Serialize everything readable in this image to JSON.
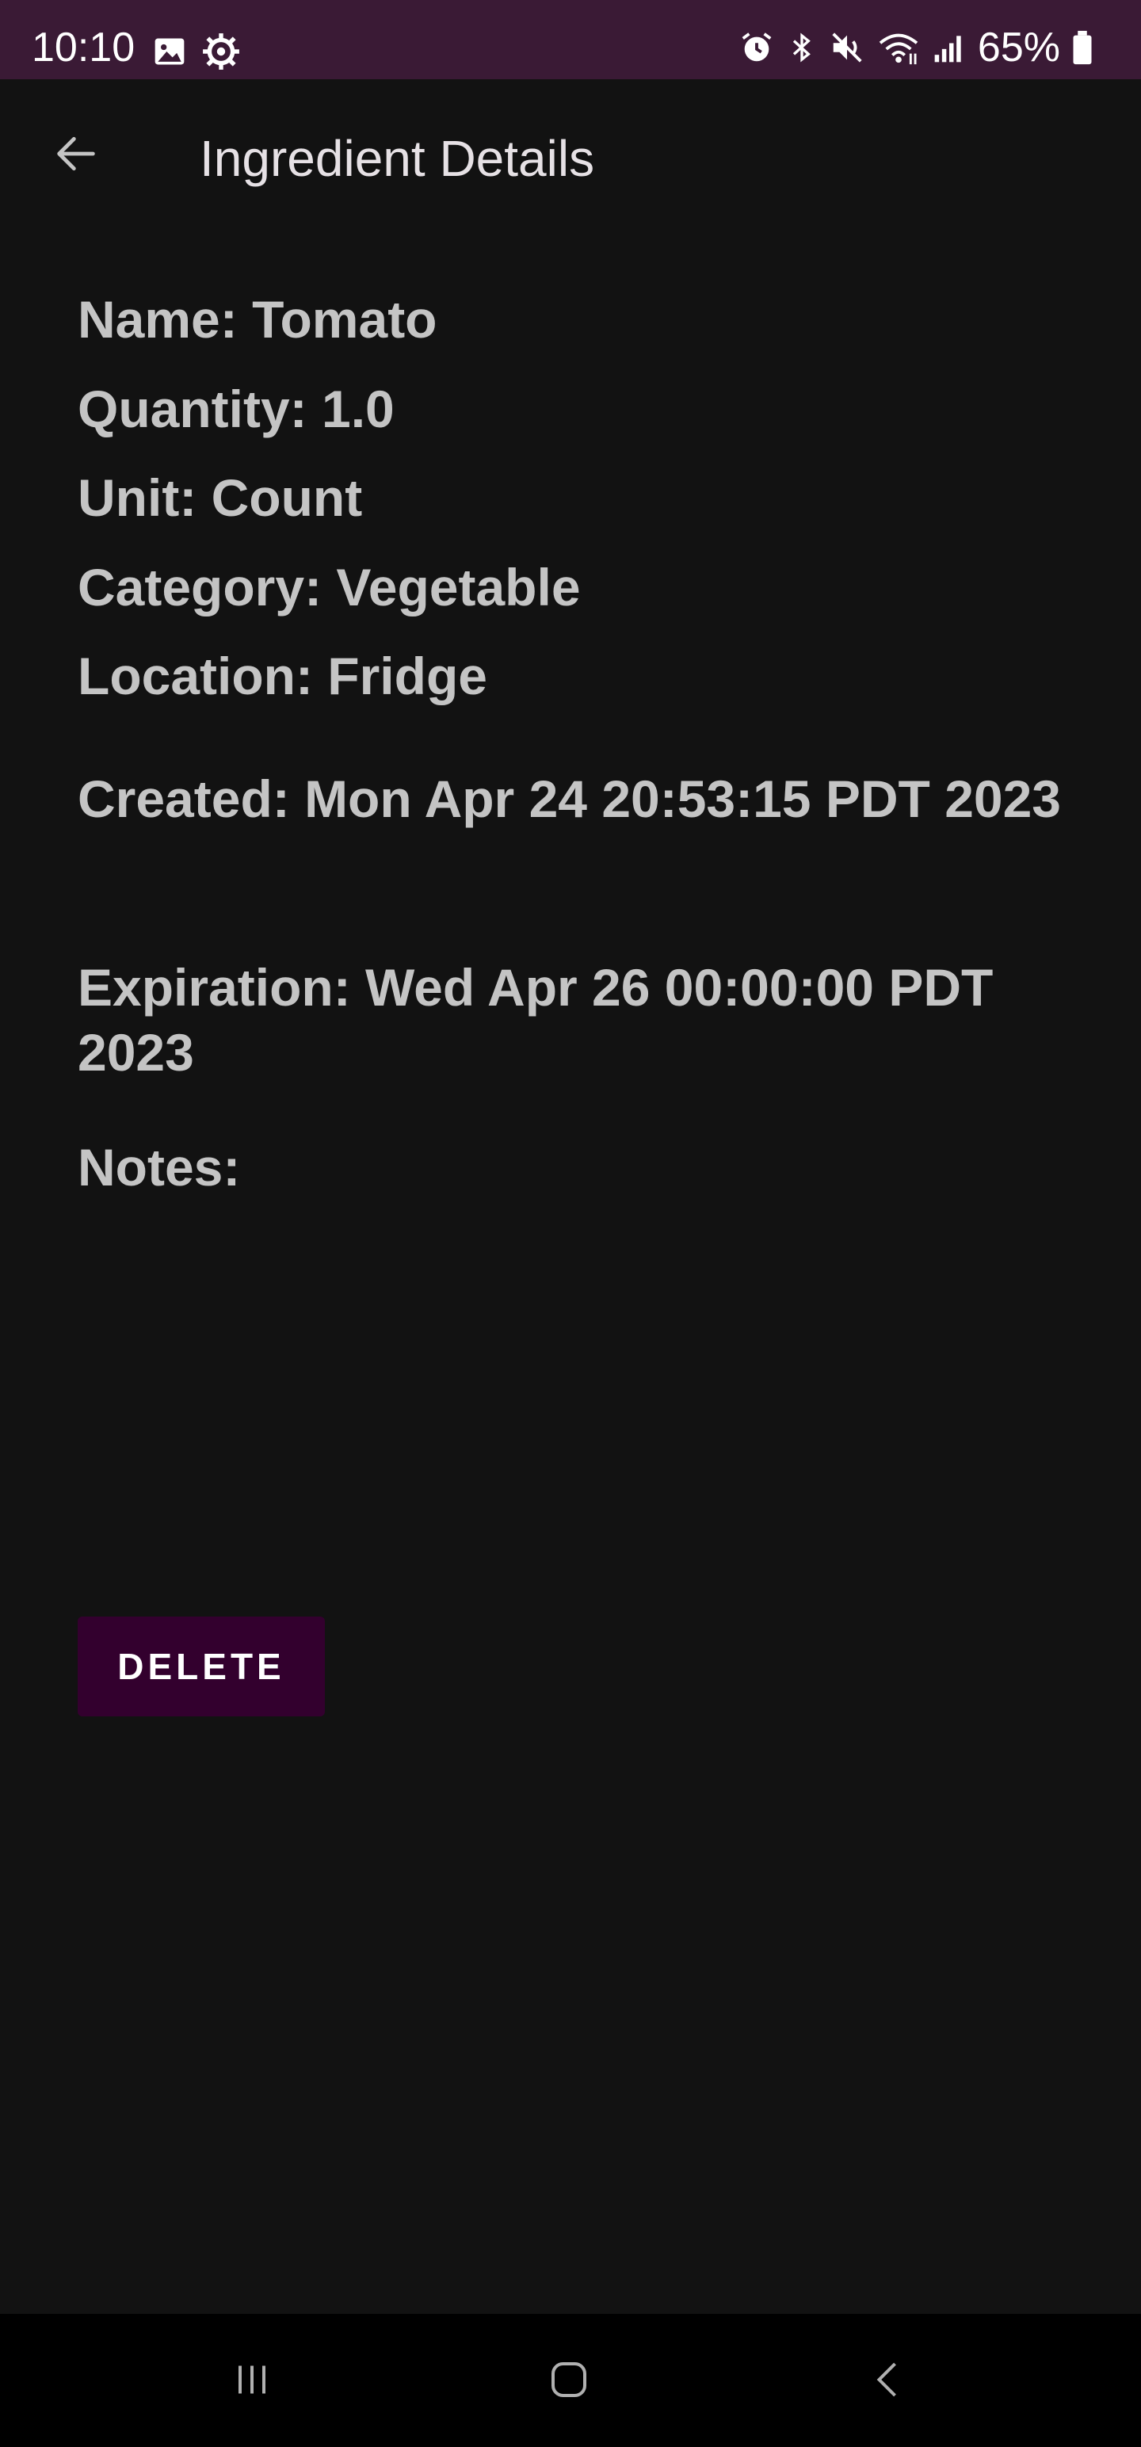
{
  "status_bar": {
    "time": "10:10",
    "battery": "65%",
    "icons": [
      "image-icon",
      "settings-gear-icon",
      "alarm-icon",
      "bluetooth-icon",
      "mute-icon",
      "wifi-icon",
      "signal-icon",
      "battery-icon"
    ]
  },
  "app_bar": {
    "title": "Ingredient Details",
    "back_icon": "arrow-back-icon"
  },
  "details": {
    "name": "Name: Tomato",
    "quantity": "Quantity: 1.0",
    "unit": "Unit: Count",
    "category": "Category: Vegetable",
    "location": "Location: Fridge",
    "created": "Created: Mon Apr 24 20:53:15 PDT 2023",
    "expiration": "Expiration: Wed Apr 26 00:00:00 PDT 2023",
    "notes": "Notes:"
  },
  "actions": {
    "delete_label": "DELETE"
  },
  "colors": {
    "status_bar_bg": "#3a1a35",
    "background": "#121212",
    "text": "#c4c4c4",
    "delete_button_bg": "#33002e"
  }
}
